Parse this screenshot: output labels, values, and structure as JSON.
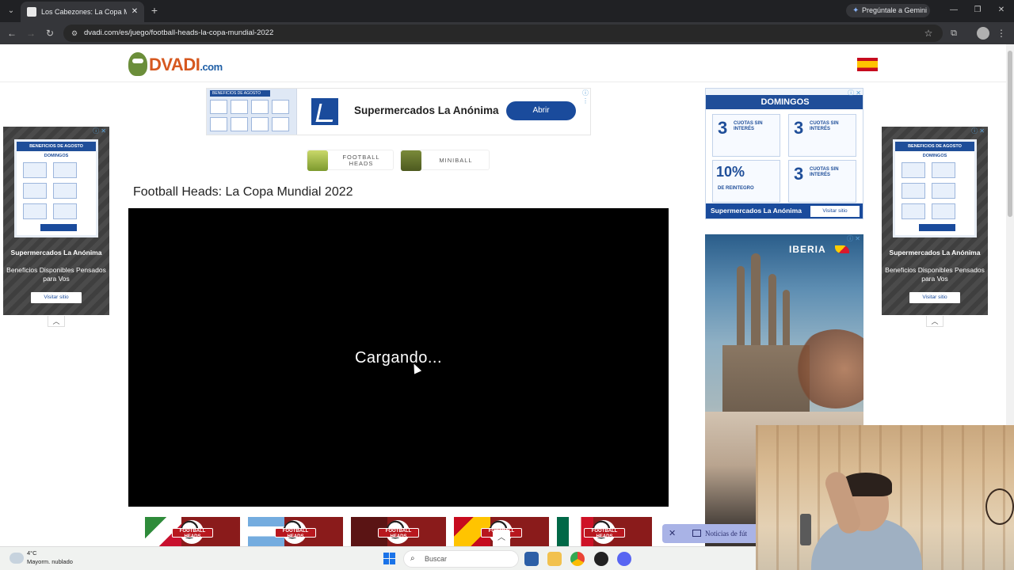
{
  "browser": {
    "tab_title": "Los Cabezones: La Copa Mundial",
    "tab_close": "✕",
    "new_tab": "+",
    "gemini_label": "Pregúntale a Gemini",
    "url": "dvadi.com/es/juego/football-heads-la-copa-mundial-2022"
  },
  "site": {
    "logo_text": "DVADI",
    "logo_suffix": ".com"
  },
  "top_ad": {
    "creative_title": "BENEFICIOS DE AGOSTO",
    "text": "Supermercados La Anónima",
    "button": "Abrir"
  },
  "game_tabs": [
    {
      "label_line1": "FOOTBALL",
      "label_line2": "HEADS"
    },
    {
      "label_line1": "MINIBALL",
      "label_line2": ""
    }
  ],
  "game": {
    "title": "Football Heads: La Copa Mundial 2022",
    "loading": "Cargando..."
  },
  "thumbnails": [
    {
      "label": "FOOTBALL HEADS"
    },
    {
      "label": "FOOTBALL HEADS"
    },
    {
      "label": "FOOTBALL HEADS"
    },
    {
      "label": "FOOTBALL HEADS"
    },
    {
      "label": "FOOTBALL HEADS"
    }
  ],
  "side_ad": {
    "card_head": "BENEFICIOS DE AGOSTO",
    "card_sub": "DOMINGOS",
    "store": "Supermercados La Anónima",
    "tagline": "Beneficios Disponibles Pensados para Vos",
    "button": "Visitar sitio"
  },
  "right_ad_1": {
    "head": "DOMINGOS",
    "big1": "3",
    "small1": "CUOTAS SIN INTERÉS",
    "big2": "3",
    "small2": "CUOTAS SIN INTERÉS",
    "big3": "10%",
    "small3": "DE REINTEGRO",
    "big4": "3",
    "small4": "CUOTAS SIN INTERÉS",
    "store": "Supermercados La Anónima",
    "button": "Visitar sitio"
  },
  "right_ad_2": {
    "brand": "IBERIA"
  },
  "notification": {
    "close": "✕",
    "text": "Noticias de fút"
  },
  "taskbar": {
    "temp": "4°C",
    "weather": "Mayorm. nublado",
    "search_placeholder": "Buscar"
  },
  "colors": {
    "chrome_bg": "#202124",
    "toolbar_bg": "#35363a",
    "brand_orange": "#d6581f",
    "anonima_blue": "#1a4b9c",
    "game_bg": "#000000"
  }
}
